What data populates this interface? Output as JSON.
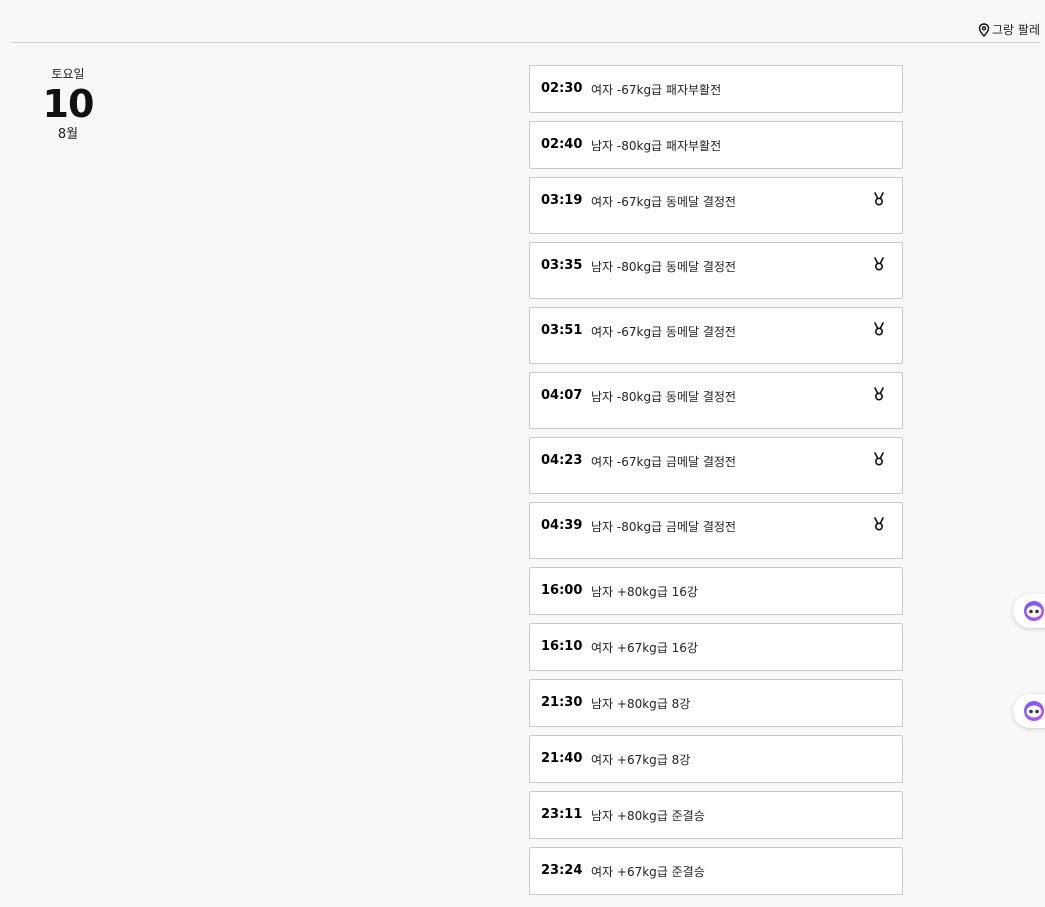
{
  "venue": {
    "name": "그랑 팔레",
    "icon": "map-pin-icon"
  },
  "date": {
    "weekday": "토요일",
    "day": "10",
    "month": "8월"
  },
  "events": [
    {
      "time": "02:30",
      "title": "여자 -67kg급 패자부활전",
      "medal": false
    },
    {
      "time": "02:40",
      "title": "남자 -80kg급 패자부활전",
      "medal": false
    },
    {
      "time": "03:19",
      "title": "여자 -67kg급 동메달 결정전",
      "medal": true
    },
    {
      "time": "03:35",
      "title": "남자 -80kg급 동메달 결정전",
      "medal": true
    },
    {
      "time": "03:51",
      "title": "여자 -67kg급 동메달 결정전",
      "medal": true
    },
    {
      "time": "04:07",
      "title": "남자 -80kg급 동메달 결정전",
      "medal": true
    },
    {
      "time": "04:23",
      "title": "여자 -67kg급 금메달 결정전",
      "medal": true
    },
    {
      "time": "04:39",
      "title": "남자 -80kg급 금메달 결정전",
      "medal": true
    },
    {
      "time": "16:00",
      "title": "남자 +80kg급 16강",
      "medal": false
    },
    {
      "time": "16:10",
      "title": "여자 +67kg급 16강",
      "medal": false
    },
    {
      "time": "21:30",
      "title": "남자 +80kg급 8강",
      "medal": false
    },
    {
      "time": "21:40",
      "title": "여자 +67kg급 8강",
      "medal": false
    },
    {
      "time": "23:11",
      "title": "남자 +80kg급 준결승",
      "medal": false
    },
    {
      "time": "23:24",
      "title": "여자 +67kg급 준결승",
      "medal": false
    }
  ],
  "icons": {
    "medal": "medal-icon",
    "assistant": "assistant-bot-icon"
  },
  "colors": {
    "assistant_gradient_start": "#6b5cff",
    "assistant_gradient_end": "#c44cff"
  }
}
